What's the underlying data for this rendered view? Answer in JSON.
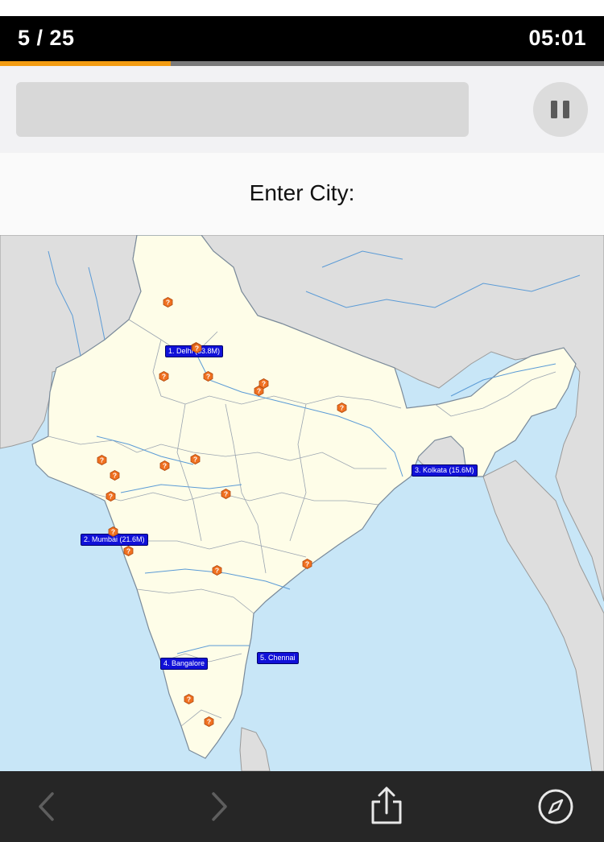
{
  "header": {
    "progress_text": "5 / 25",
    "timer": "05:01",
    "progress_fraction": 0.2833,
    "accent_color": "#f39c12"
  },
  "input": {
    "value": "",
    "placeholder": ""
  },
  "controls": {
    "pause_icon": "pause-icon"
  },
  "prompt": {
    "text": "Enter City:"
  },
  "map": {
    "found_cities": [
      {
        "rank": 1,
        "label": "1. Delhi (33.8M)"
      },
      {
        "rank": 2,
        "label": "2. Mumbai (21.6M)"
      },
      {
        "rank": 3,
        "label": "3. Kolkata (15.6M)"
      },
      {
        "rank": 4,
        "label": "4. Bangalore"
      },
      {
        "rank": 5,
        "label": "5. Chennai"
      }
    ],
    "unknown_marker_icon": "question-mark-icon",
    "unknown_marker_count": 20,
    "colors": {
      "land_india": "#fefde8",
      "land_other": "#dedede",
      "water": "#c8e6f7",
      "river": "#5b9bd6",
      "label_bg": "#1010d8",
      "marker": "#f07020"
    }
  },
  "toolbar": {
    "back_icon": "chevron-left-icon",
    "forward_icon": "chevron-right-icon",
    "share_icon": "share-icon",
    "compass_icon": "compass-icon"
  }
}
